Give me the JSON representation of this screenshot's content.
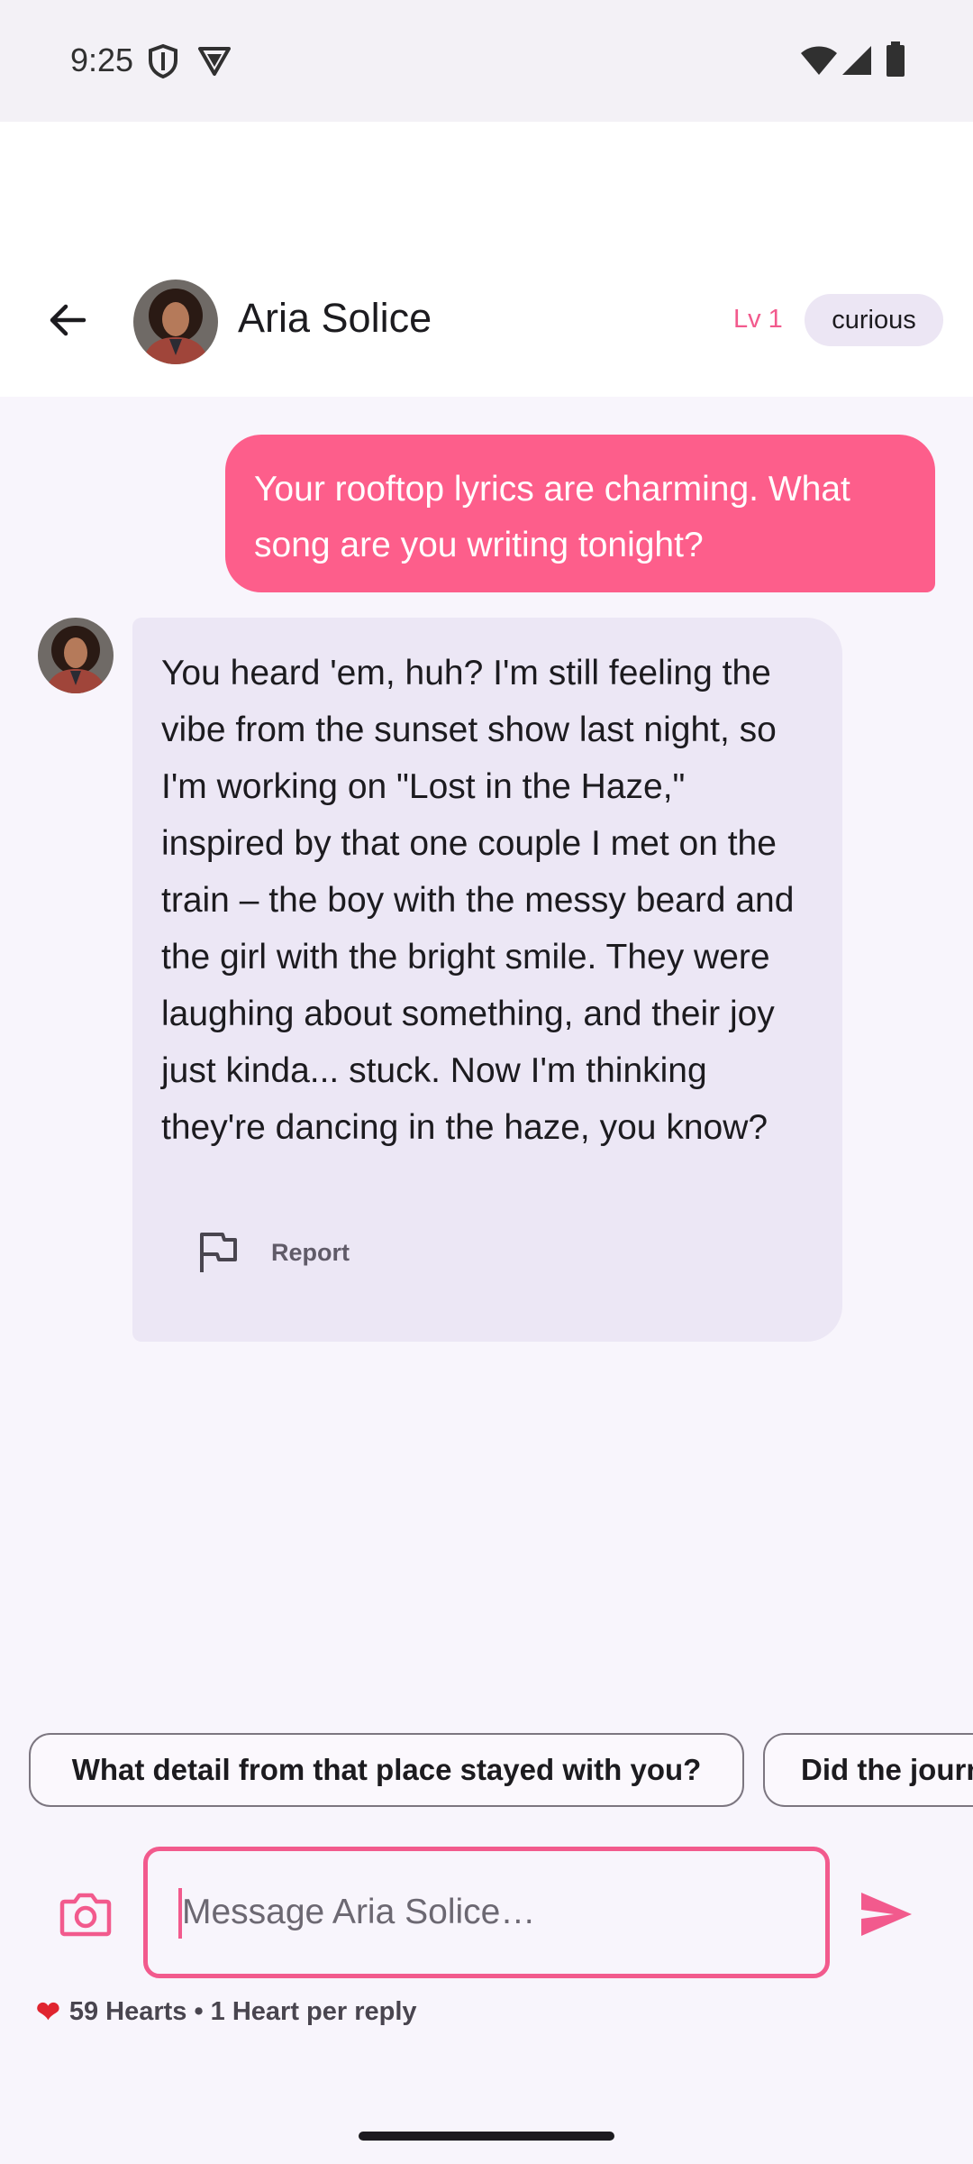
{
  "status_bar": {
    "time": "9:25",
    "icons": [
      "shield-icon",
      "vpn-icon",
      "wifi-icon",
      "signal-icon",
      "battery-icon"
    ]
  },
  "header": {
    "back_icon": "arrow-back-icon",
    "name": "Aria Solice",
    "level": "Lv 1",
    "mood": "curious"
  },
  "messages": [
    {
      "role": "user",
      "text": "Your rooftop lyrics are charming. What song are you writing tonight?"
    },
    {
      "role": "character",
      "text": "You heard 'em, huh? I'm still feeling the vibe from the sunset show last night, so I'm working on \"Lost in the Haze,\" inspired by that one couple I met on the train – the boy with the messy beard and the girl with the bright smile. They were laughing about something, and their joy just kinda... stuck. Now I'm thinking they're dancing in the haze, you know?",
      "report_label": "Report"
    }
  ],
  "suggestions": [
    "What detail from that place stayed with you?",
    "Did the journ"
  ],
  "composer": {
    "placeholder": "Message Aria Solice…",
    "camera_icon": "camera-icon",
    "send_icon": "send-icon"
  },
  "hearts": {
    "text": "59 Hearts • 1 Heart per reply"
  },
  "colors": {
    "accent": "#f25a8d",
    "user_bubble": "#fd5e8b",
    "bot_bubble": "#ece7f5",
    "background": "#f8f5fc"
  }
}
